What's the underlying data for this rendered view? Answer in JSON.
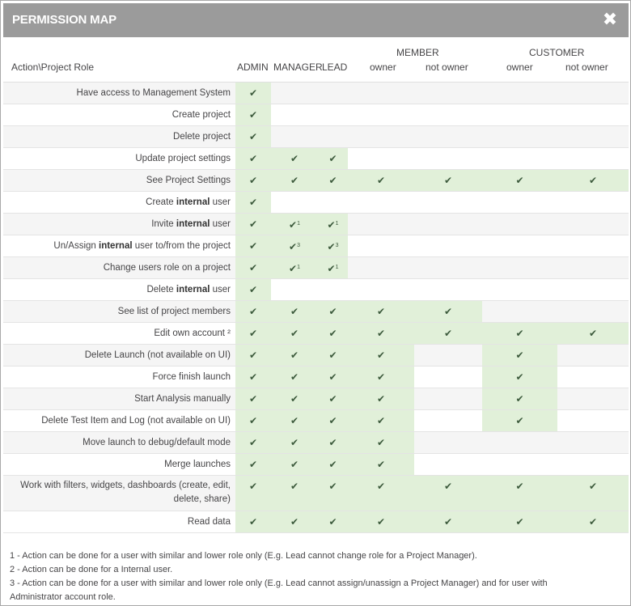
{
  "modal": {
    "title": "PERMISSION MAP",
    "close_glyph": "✖"
  },
  "header": {
    "action_role": "Action\\Project Role",
    "admin": "ADMIN",
    "manager": "MANAGER",
    "lead": "LEAD",
    "member": "MEMBER",
    "member_owner": "owner",
    "member_not_owner": "not owner",
    "customer": "CUSTOMER",
    "customer_owner": "owner",
    "customer_not_owner": "not owner"
  },
  "check_glyph": "✔",
  "rows": [
    {
      "pre": "Have access to Management System",
      "bold": "",
      "post": "",
      "cells": [
        "1",
        "",
        "",
        "",
        "",
        "",
        ""
      ]
    },
    {
      "pre": "Create project",
      "bold": "",
      "post": "",
      "cells": [
        "1",
        "",
        "",
        "",
        "",
        "",
        ""
      ]
    },
    {
      "pre": "Delete project",
      "bold": "",
      "post": "",
      "cells": [
        "1",
        "",
        "",
        "",
        "",
        "",
        ""
      ]
    },
    {
      "pre": "Update project settings",
      "bold": "",
      "post": "",
      "cells": [
        "1",
        "1",
        "1",
        "",
        "",
        "",
        ""
      ]
    },
    {
      "pre": "See Project Settings",
      "bold": "",
      "post": "",
      "cells": [
        "1",
        "1",
        "1",
        "1",
        "1",
        "1",
        "1"
      ]
    },
    {
      "pre": "Create ",
      "bold": "internal",
      "post": " user",
      "cells": [
        "1",
        "",
        "",
        "",
        "",
        "",
        ""
      ]
    },
    {
      "pre": "Invite ",
      "bold": "internal",
      "post": " user",
      "cells": [
        "1",
        "1^1",
        "1^1",
        "",
        "",
        "",
        ""
      ]
    },
    {
      "pre": "Un/Assign ",
      "bold": "internal",
      "post": " user to/from the project",
      "cells": [
        "1",
        "1^3",
        "1^3",
        "",
        "",
        "",
        ""
      ]
    },
    {
      "pre": "Change users role on a project",
      "bold": "",
      "post": "",
      "cells": [
        "1",
        "1^1",
        "1^1",
        "",
        "",
        "",
        ""
      ]
    },
    {
      "pre": "Delete ",
      "bold": "internal",
      "post": " user",
      "cells": [
        "1",
        "",
        "",
        "",
        "",
        "",
        ""
      ]
    },
    {
      "pre": "See list of project members",
      "bold": "",
      "post": "",
      "cells": [
        "1",
        "1",
        "1",
        "1",
        "1",
        "",
        ""
      ]
    },
    {
      "pre": "Edit own account ²",
      "bold": "",
      "post": "",
      "cells": [
        "1",
        "1",
        "1",
        "1",
        "1",
        "1",
        "1"
      ]
    },
    {
      "pre": "Delete Launch (not available on UI)",
      "bold": "",
      "post": "",
      "cells": [
        "1",
        "1",
        "1",
        "1",
        "",
        "1",
        ""
      ]
    },
    {
      "pre": "Force finish launch",
      "bold": "",
      "post": "",
      "cells": [
        "1",
        "1",
        "1",
        "1",
        "",
        "1",
        ""
      ]
    },
    {
      "pre": "Start Analysis manually",
      "bold": "",
      "post": "",
      "cells": [
        "1",
        "1",
        "1",
        "1",
        "",
        "1",
        ""
      ]
    },
    {
      "pre": "Delete Test Item and Log (not available on UI)",
      "bold": "",
      "post": "",
      "cells": [
        "1",
        "1",
        "1",
        "1",
        "",
        "1",
        ""
      ]
    },
    {
      "pre": "Move launch to debug/default mode",
      "bold": "",
      "post": "",
      "cells": [
        "1",
        "1",
        "1",
        "1",
        "",
        "",
        ""
      ]
    },
    {
      "pre": "Merge launches",
      "bold": "",
      "post": "",
      "cells": [
        "1",
        "1",
        "1",
        "1",
        "",
        "",
        ""
      ]
    },
    {
      "pre": "Work with filters, widgets, dashboards (create, edit, delete, share)",
      "bold": "",
      "post": "",
      "cells": [
        "1",
        "1",
        "1",
        "1",
        "1",
        "1",
        "1"
      ],
      "tall": true
    },
    {
      "pre": "Read data",
      "bold": "",
      "post": "",
      "cells": [
        "1",
        "1",
        "1",
        "1",
        "1",
        "1",
        "1"
      ]
    }
  ],
  "notes": [
    "1 - Action can be done for a user with similar and lower role only (E.g. Lead cannot change role for a Project Manager).",
    "2 - Action can be done for a Internal user.",
    "3 - Action can be done for a user with similar and lower role only (E.g. Lead cannot assign/unassign a Project Manager) and for user with Administrator account role."
  ]
}
